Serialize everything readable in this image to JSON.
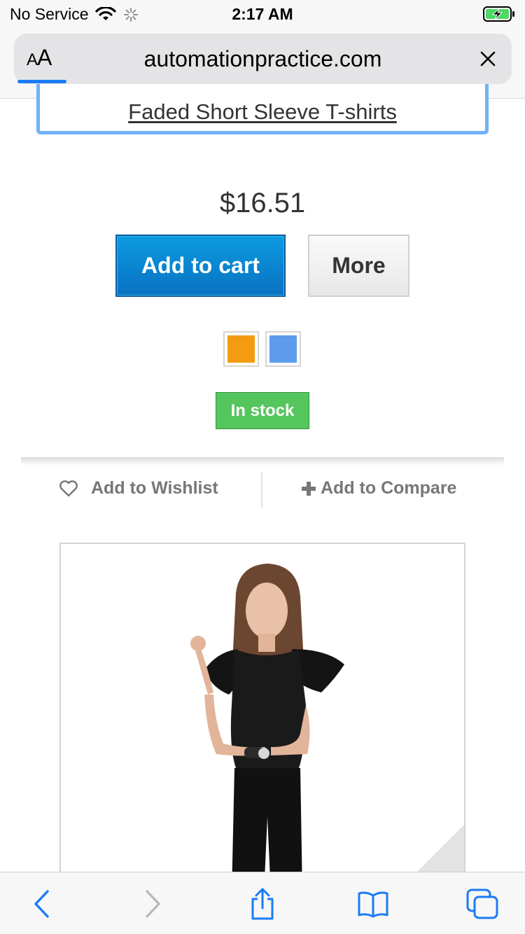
{
  "status_bar": {
    "carrier": "No Service",
    "time": "2:17 AM",
    "icons": [
      "wifi-icon",
      "activity-spinner-icon",
      "battery-charging-icon"
    ]
  },
  "browser": {
    "aa_large": "A",
    "aa_small": "A",
    "url": "automationpractice.com",
    "load_progress": 0.1,
    "accent_color": "#1a7cf5"
  },
  "product": {
    "title": "Faded Short Sleeve T-shirts",
    "price": "$16.51",
    "add_to_cart_label": "Add to cart",
    "more_label": "More",
    "color_swatches": [
      {
        "name": "orange",
        "color": "#f39c11"
      },
      {
        "name": "blue",
        "color": "#5d9cec"
      }
    ],
    "availability": "In stock",
    "wishlist_label": "Add to Wishlist",
    "compare_label": "Add to Compare"
  },
  "toolbar": {
    "buttons": [
      "back-icon",
      "forward-icon",
      "share-icon",
      "bookmarks-icon",
      "tabs-icon"
    ]
  }
}
